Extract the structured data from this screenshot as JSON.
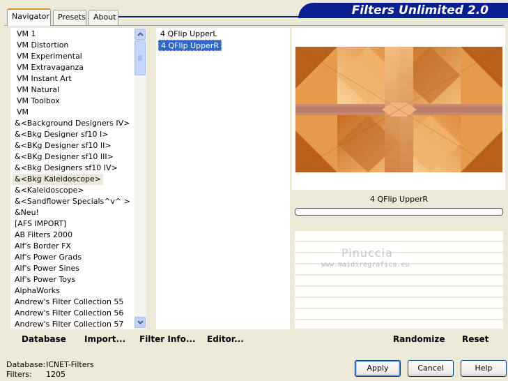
{
  "app": {
    "title": "Filters Unlimited 2.0"
  },
  "tabs": [
    {
      "label": "Navigator"
    },
    {
      "label": "Presets"
    },
    {
      "label": "About"
    }
  ],
  "categories": {
    "items": [
      "VM 1",
      "VM Distortion",
      "VM Experimental",
      "VM Extravaganza",
      "VM Instant Art",
      "VM Natural",
      "VM Toolbox",
      "VM",
      "&<Background Designers IV>",
      "&<Bkg Designer sf10 I>",
      "&<BKg Designer sf10 II>",
      "&<BKg Designer sf10 III>",
      "&<Bkg Designers sf10 IV>",
      "&<Bkg Kaleidoscope>",
      "&<Kaleidoscope>",
      "&<Sandflower Specials^v^ >",
      "&Neu!",
      "[AFS IMPORT]",
      "AB Filters 2000",
      "Alf's Border FX",
      "Alf's Power Grads",
      "Alf's Power Sines",
      "Alf's Power Toys",
      "AlphaWorks",
      "Andrew's Filter Collection 55",
      "Andrew's Filter Collection 56",
      "Andrew's Filter Collection 57"
    ],
    "selected_index": 13
  },
  "filters": {
    "items": [
      "4 QFlip UpperL",
      "4 QFlip UpperR"
    ],
    "selected_index": 1
  },
  "preview": {
    "filter_name": "4 QFlip UpperR"
  },
  "watermark": {
    "line1": "Pinuccia",
    "line2": "www.maidiregrafica.eu"
  },
  "toolbar": {
    "database": "Database",
    "import": "Import...",
    "filter_info": "Filter Info...",
    "editor": "Editor...",
    "randomize": "Randomize",
    "reset": "Reset"
  },
  "status": {
    "database_label": "Database:",
    "database_value": "ICNET-Filters",
    "filters_label": "Filters:",
    "filters_value": "1205"
  },
  "buttons": {
    "apply": "Apply",
    "cancel": "Cancel",
    "help": "Help"
  },
  "colors": {
    "banner": "#0a1f8f",
    "selection": "#316ac5",
    "tab_accent": "#e68b2c"
  }
}
